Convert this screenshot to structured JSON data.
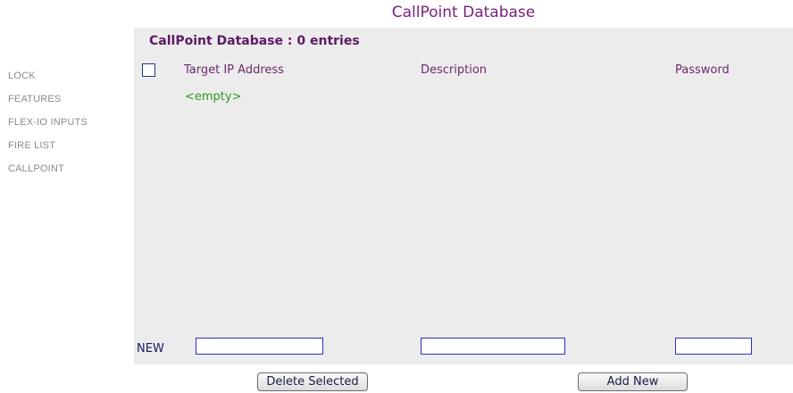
{
  "page": {
    "title": "CallPoint Database"
  },
  "sidebar": {
    "items": [
      {
        "label": "LOCK"
      },
      {
        "label": "FEATURES"
      },
      {
        "label": "FLEX-IO INPUTS"
      },
      {
        "label": "FIRE LIST"
      },
      {
        "label": "CALLPOINT"
      }
    ]
  },
  "panel": {
    "heading": "CallPoint Database : 0 entries",
    "columns": [
      "Target IP Address",
      "Description",
      "Password"
    ],
    "select_all_checked": false,
    "empty_text": "<empty>",
    "new_row": {
      "label": "NEW",
      "ip_value": "",
      "description_value": "",
      "password_value": ""
    }
  },
  "buttons": {
    "delete_label": "Delete Selected",
    "add_label": "Add New"
  },
  "colors": {
    "title": "#7a1f7a",
    "panel_bg": "#ececec",
    "empty_text": "#2f9a20",
    "sidebar_text": "#8a8a8a"
  }
}
